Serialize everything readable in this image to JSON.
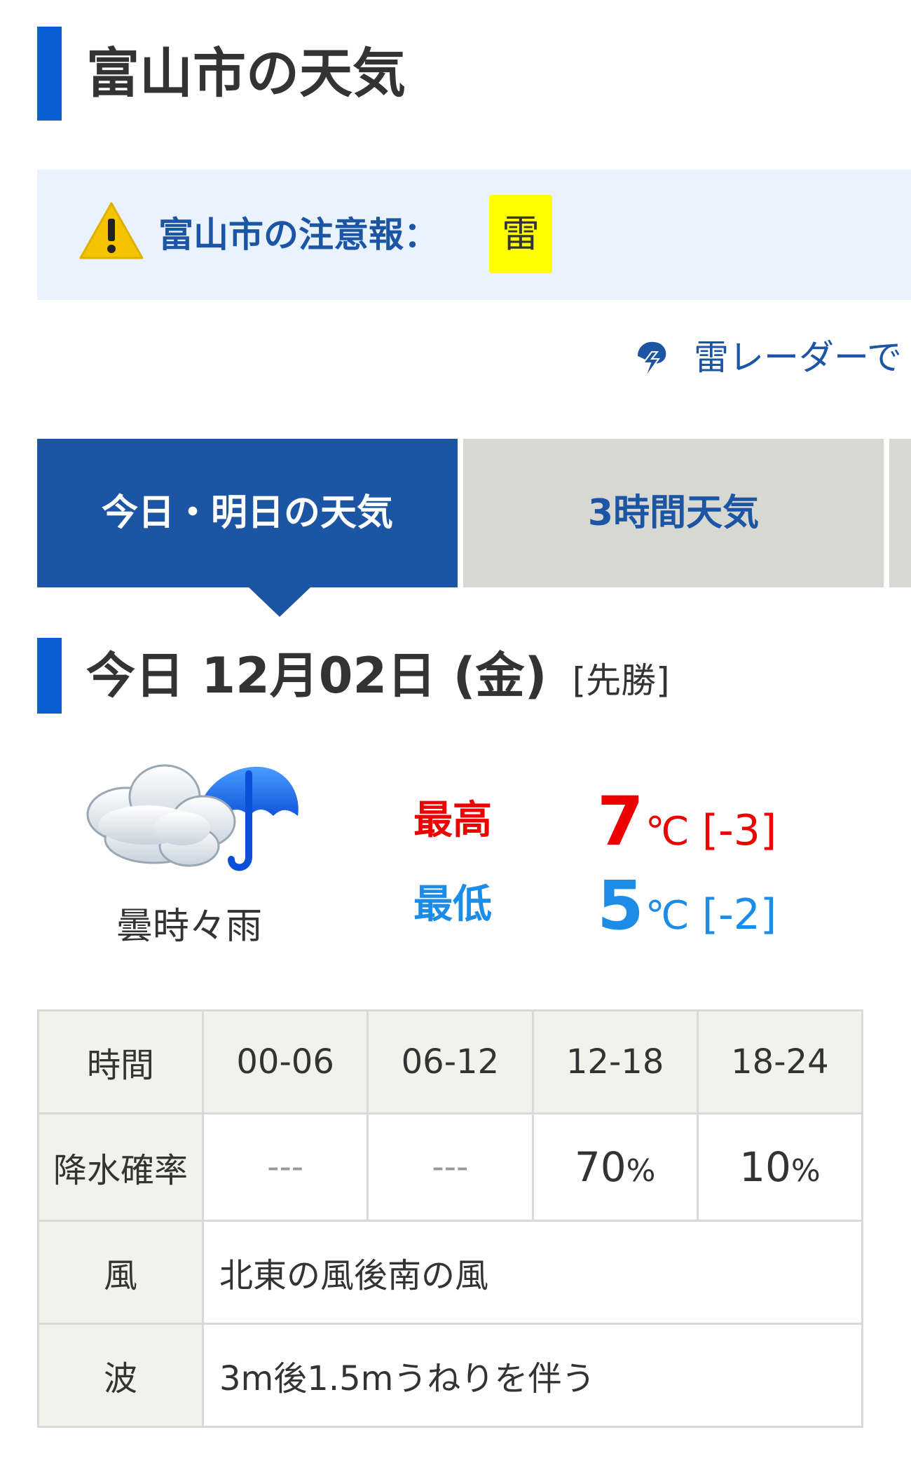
{
  "page": {
    "title": "富山市の天気"
  },
  "warning": {
    "label": "富山市の注意報：",
    "items": [
      "雷"
    ],
    "icon": "warning-triangle-icon",
    "colors": {
      "badge": "#ffff00",
      "icon": "#f5c400",
      "text": "#1d55a5"
    }
  },
  "radar_link": {
    "label": "雷レーダーで",
    "icon": "lightning-bolt-icon"
  },
  "tabs": [
    {
      "label": "今日・明日の天気",
      "active": true
    },
    {
      "label": "3時間天気",
      "active": false
    }
  ],
  "today": {
    "heading": "今日 12月02日 (金)",
    "rokuyo": "[先勝]",
    "weather": "曇時々雨",
    "weather_icon": "cloud-with-umbrella-icon",
    "high": {
      "label": "最高",
      "value": "7",
      "unit": "℃",
      "diff": "[-3]",
      "color": "#ee0000"
    },
    "low": {
      "label": "最低",
      "value": "5",
      "unit": "℃",
      "diff": "[-2]",
      "color": "#1b8de8"
    }
  },
  "table": {
    "time": {
      "header": "時間",
      "slots": [
        "00-06",
        "06-12",
        "12-18",
        "18-24"
      ]
    },
    "precip": {
      "header": "降水確率",
      "values": [
        "---",
        "---",
        "70",
        "10"
      ],
      "unit": "%"
    },
    "wind": {
      "header": "風",
      "value": "北東の風後南の風"
    },
    "wave": {
      "header": "波",
      "value": "3m後1.5mうねりを伴う"
    }
  }
}
